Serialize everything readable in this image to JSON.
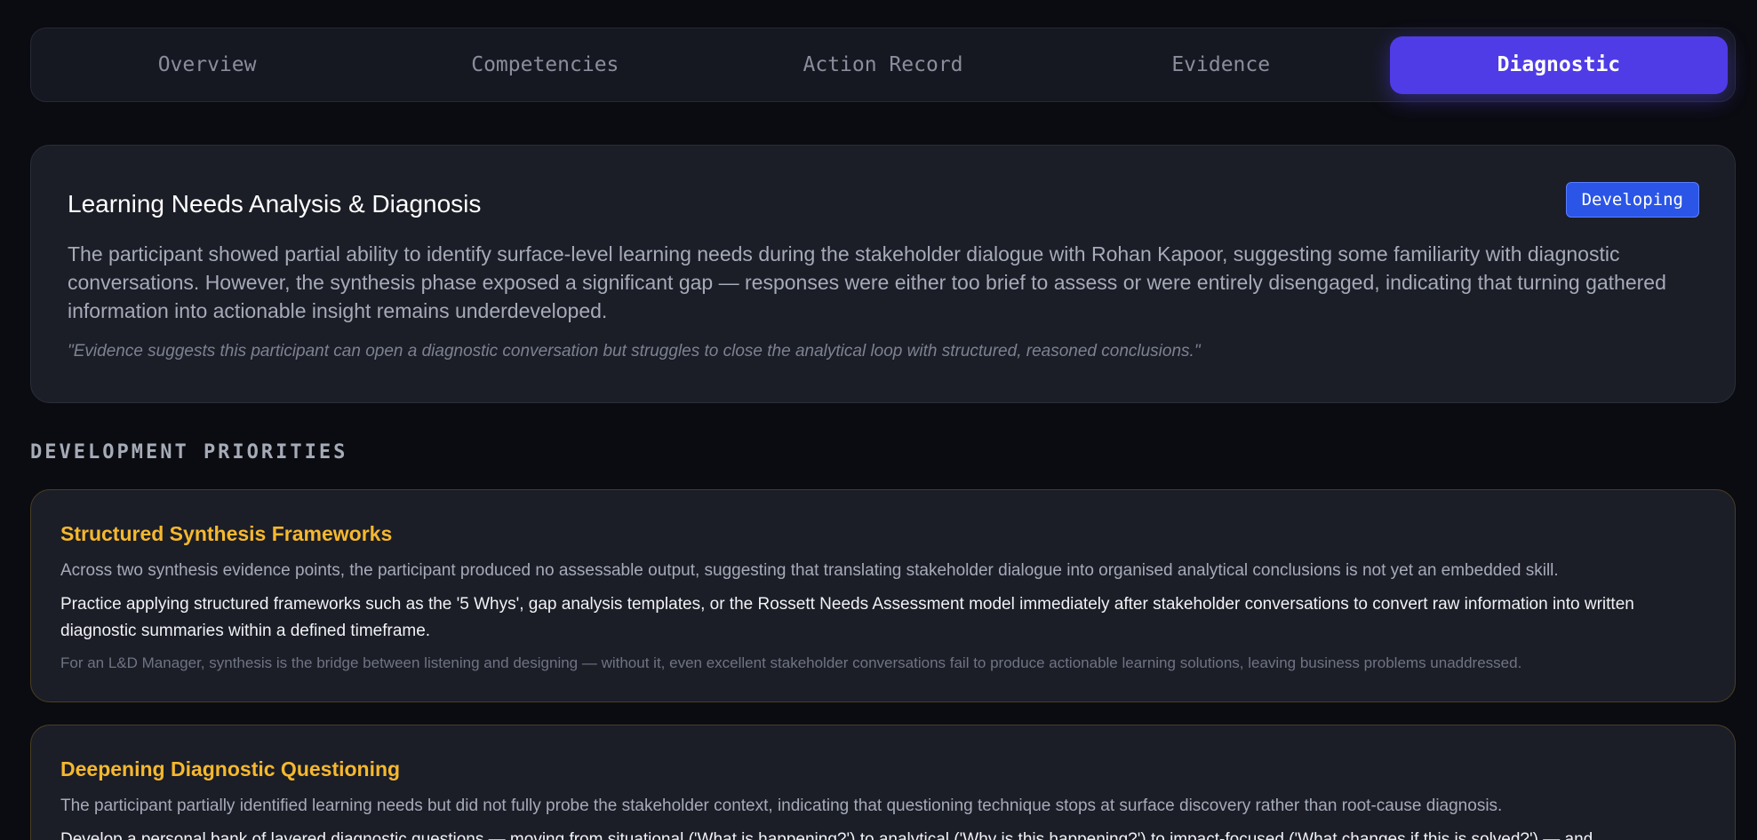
{
  "tabs": [
    {
      "label": "Overview",
      "active": false
    },
    {
      "label": "Competencies",
      "active": false
    },
    {
      "label": "Action Record",
      "active": false
    },
    {
      "label": "Evidence",
      "active": false
    },
    {
      "label": "Diagnostic",
      "active": true
    }
  ],
  "summary": {
    "title": "Learning Needs Analysis & Diagnosis",
    "badge": "Developing",
    "text": "The participant showed partial ability to identify surface-level learning needs during the stakeholder dialogue with Rohan Kapoor, suggesting some familiarity with diagnostic conversations. However, the synthesis phase exposed a significant gap — responses were either too brief to assess or were entirely disengaged, indicating that turning gathered information into actionable insight remains underdeveloped.",
    "quote": "\"Evidence suggests this participant can open a diagnostic conversation but struggles to close the analytical loop with structured, reasoned conclusions.\""
  },
  "priorities_heading": "DEVELOPMENT PRIORITIES",
  "priorities": [
    {
      "title": "Structured Synthesis Frameworks",
      "observation": "Across two synthesis evidence points, the participant produced no assessable output, suggesting that translating stakeholder dialogue into organised analytical conclusions is not yet an embedded skill.",
      "action": "Practice applying structured frameworks such as the '5 Whys', gap analysis templates, or the Rossett Needs Assessment model immediately after stakeholder conversations to convert raw information into written diagnostic summaries within a defined timeframe.",
      "rationale": "For an L&D Manager, synthesis is the bridge between listening and designing — without it, even excellent stakeholder conversations fail to produce actionable learning solutions, leaving business problems unaddressed."
    },
    {
      "title": "Deepening Diagnostic Questioning",
      "observation": "The participant partially identified learning needs but did not fully probe the stakeholder context, indicating that questioning technique stops at surface discovery rather than root-cause diagnosis.",
      "action": "Develop a personal bank of layered diagnostic questions — moving from situational ('What is happening?') to analytical ('Why is this happening?') to impact-focused ('What changes if this is solved?') — and",
      "rationale": ""
    }
  ],
  "colors": {
    "background": "#0b0c11",
    "card": "#1b1d27",
    "active_tab": "#4f3ce6",
    "badge": "#2a55e6",
    "priority_title": "#f5b82e",
    "priority_border": "#4a3f24"
  }
}
